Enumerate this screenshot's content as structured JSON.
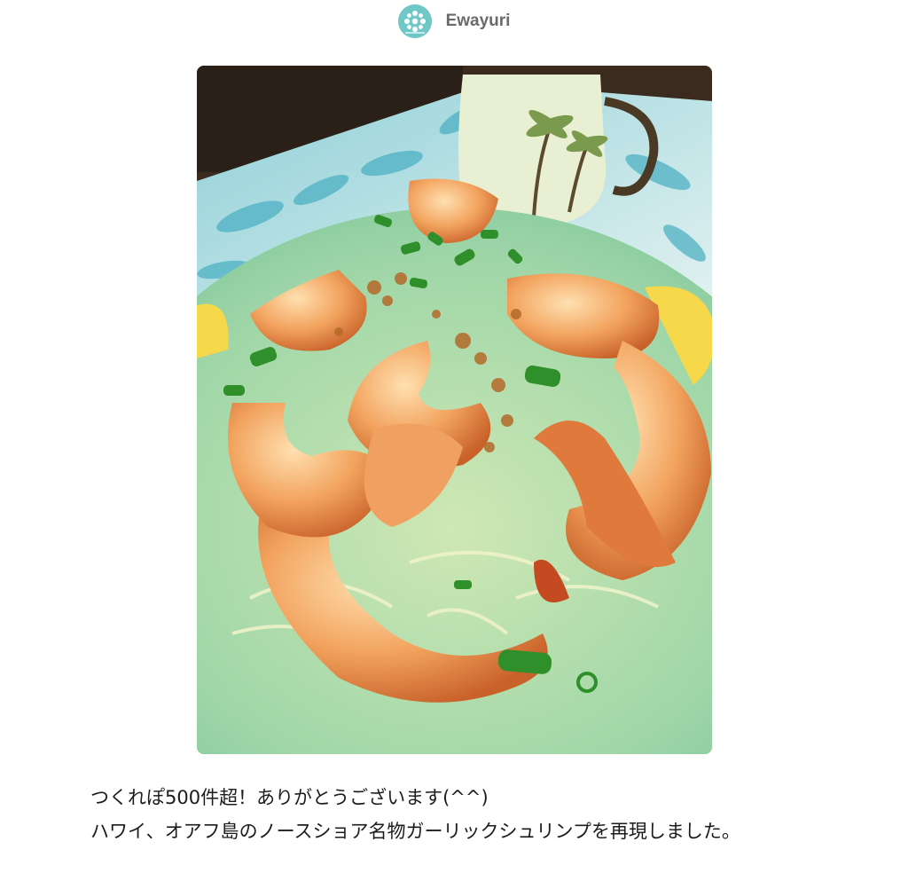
{
  "author": {
    "name": "Ewayuri",
    "avatar_icon": "snowflake-flower-icon",
    "avatar_color": "#6fc8c6"
  },
  "photo": {
    "subject": "garlic-shrimp-plate-image"
  },
  "description": {
    "line1": "つくれぽ500件超！ありがとうございます(^^)",
    "line2": "ハワイ、オアフ島のノースショア名物ガーリックシュリンプを再現しました。"
  }
}
